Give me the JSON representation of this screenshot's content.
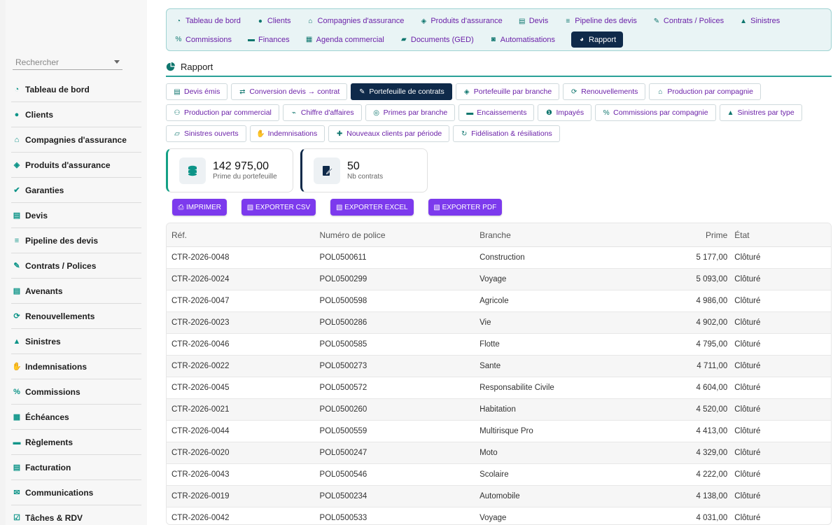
{
  "sidebar": {
    "search_placeholder": "Rechercher",
    "items": [
      {
        "label": "Tableau de bord",
        "icon": "dashboard-icon"
      },
      {
        "label": "Clients",
        "icon": "user-icon"
      },
      {
        "label": "Compagnies d'assurance",
        "icon": "bank-icon"
      },
      {
        "label": "Produits d'assurance",
        "icon": "shield-icon"
      },
      {
        "label": "Garanties",
        "icon": "check-circle-icon"
      },
      {
        "label": "Devis",
        "icon": "file-icon"
      },
      {
        "label": "Pipeline des devis",
        "icon": "list-icon"
      },
      {
        "label": "Contrats / Polices",
        "icon": "contract-icon"
      },
      {
        "label": "Avenants",
        "icon": "file-icon"
      },
      {
        "label": "Renouvellements",
        "icon": "sync-icon"
      },
      {
        "label": "Sinistres",
        "icon": "warning-icon"
      },
      {
        "label": "Indemnisations",
        "icon": "hand-money-icon"
      },
      {
        "label": "Commissions",
        "icon": "percent-icon"
      },
      {
        "label": "Échéances",
        "icon": "calendar-icon"
      },
      {
        "label": "Règlements",
        "icon": "money-icon"
      },
      {
        "label": "Facturation",
        "icon": "invoice-icon"
      },
      {
        "label": "Communications",
        "icon": "chat-icon"
      },
      {
        "label": "Tâches & RDV",
        "icon": "tasks-icon"
      }
    ]
  },
  "topnav": {
    "row1": [
      {
        "label": "Tableau de bord",
        "icon": "dashboard-icon"
      },
      {
        "label": "Clients",
        "icon": "user-icon"
      },
      {
        "label": "Compagnies d'assurance",
        "icon": "bank-icon"
      },
      {
        "label": "Produits d'assurance",
        "icon": "shield-icon"
      },
      {
        "label": "Devis",
        "icon": "file-icon"
      },
      {
        "label": "Pipeline des devis",
        "icon": "list-icon"
      },
      {
        "label": "Contrats / Polices",
        "icon": "contract-icon"
      },
      {
        "label": "Sinistres",
        "icon": "warning-icon"
      }
    ],
    "row2": [
      {
        "label": "Commissions",
        "icon": "percent-icon"
      },
      {
        "label": "Finances",
        "icon": "money-icon"
      },
      {
        "label": "Agenda commercial",
        "icon": "calendar-icon"
      },
      {
        "label": "Documents (GED)",
        "icon": "folder-icon"
      },
      {
        "label": "Automatisations",
        "icon": "robot-icon"
      },
      {
        "label": "Rapport",
        "icon": "pie-chart-icon",
        "active": true
      }
    ]
  },
  "page": {
    "title": "Rapport"
  },
  "reports": {
    "row1": [
      {
        "label": "Devis émis",
        "icon": "file-icon"
      },
      {
        "label": "Conversion devis → contrat",
        "icon": "exchange-icon"
      },
      {
        "label": "Portefeuille de contrats",
        "icon": "contract-icon",
        "active": true
      },
      {
        "label": "Portefeuille par branche",
        "icon": "shield-icon"
      },
      {
        "label": "Renouvellements",
        "icon": "sync-icon"
      },
      {
        "label": "Production par compagnie",
        "icon": "bank-icon"
      }
    ],
    "row2": [
      {
        "label": "Production par commercial",
        "icon": "users-icon"
      },
      {
        "label": "Chiffre d'affaires",
        "icon": "chart-line-icon"
      },
      {
        "label": "Primes par branche",
        "icon": "coins-icon"
      },
      {
        "label": "Encaissements",
        "icon": "money-icon"
      },
      {
        "label": "Impayés",
        "icon": "alert-circle-icon"
      },
      {
        "label": "Commissions par compagnie",
        "icon": "percent-icon"
      },
      {
        "label": "Sinistres par type",
        "icon": "warning-icon"
      }
    ],
    "row3": [
      {
        "label": "Sinistres ouverts",
        "icon": "folder-open-icon"
      },
      {
        "label": "Indemnisations",
        "icon": "hand-money-icon"
      },
      {
        "label": "Nouveaux clients par période",
        "icon": "user-plus-icon"
      },
      {
        "label": "Fidélisation & résiliations",
        "icon": "refresh-icon"
      }
    ]
  },
  "kpis": [
    {
      "value": "142 975,00",
      "label": "Prime du portefeuille",
      "icon": "coins-icon"
    },
    {
      "value": "50",
      "label": "Nb contrats",
      "icon": "contract-icon"
    }
  ],
  "exports": [
    {
      "label": "IMPRIMER",
      "icon": "print-icon"
    },
    {
      "label": "EXPORTER CSV",
      "icon": "file-csv-icon"
    },
    {
      "label": "EXPORTER EXCEL",
      "icon": "file-excel-icon"
    },
    {
      "label": "EXPORTER PDF",
      "icon": "file-pdf-icon"
    }
  ],
  "table": {
    "headers": [
      "Réf.",
      "Numéro de police",
      "Branche",
      "Prime",
      "État"
    ],
    "rows": [
      [
        "CTR-2026-0048",
        "POL0500611",
        "Construction",
        "5 177,00",
        "Clôturé"
      ],
      [
        "CTR-2026-0024",
        "POL0500299",
        "Voyage",
        "5 093,00",
        "Clôturé"
      ],
      [
        "CTR-2026-0047",
        "POL0500598",
        "Agricole",
        "4 986,00",
        "Clôturé"
      ],
      [
        "CTR-2026-0023",
        "POL0500286",
        "Vie",
        "4 902,00",
        "Clôturé"
      ],
      [
        "CTR-2026-0046",
        "POL0500585",
        "Flotte",
        "4 795,00",
        "Clôturé"
      ],
      [
        "CTR-2026-0022",
        "POL0500273",
        "Sante",
        "4 711,00",
        "Clôturé"
      ],
      [
        "CTR-2026-0045",
        "POL0500572",
        "Responsabilite Civile",
        "4 604,00",
        "Clôturé"
      ],
      [
        "CTR-2026-0021",
        "POL0500260",
        "Habitation",
        "4 520,00",
        "Clôturé"
      ],
      [
        "CTR-2026-0044",
        "POL0500559",
        "Multirisque Pro",
        "4 413,00",
        "Clôturé"
      ],
      [
        "CTR-2026-0020",
        "POL0500247",
        "Moto",
        "4 329,00",
        "Clôturé"
      ],
      [
        "CTR-2026-0043",
        "POL0500546",
        "Scolaire",
        "4 222,00",
        "Clôturé"
      ],
      [
        "CTR-2026-0019",
        "POL0500234",
        "Automobile",
        "4 138,00",
        "Clôturé"
      ],
      [
        "CTR-2026-0042",
        "POL0500533",
        "Voyage",
        "4 031,00",
        "Clôturé"
      ]
    ]
  },
  "colors": {
    "accent": "#0d9488",
    "nav_active": "#0f2a4a",
    "link": "#6b21a8",
    "export": "#7c3aed"
  }
}
